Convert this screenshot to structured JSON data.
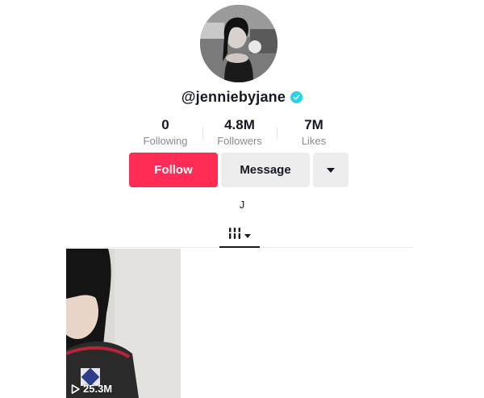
{
  "profile": {
    "handle": "@jenniebyjane",
    "verified": true,
    "bio": "J"
  },
  "stats": [
    {
      "value": "0",
      "label": "Following"
    },
    {
      "value": "4.8M",
      "label": "Followers"
    },
    {
      "value": "7M",
      "label": "Likes"
    }
  ],
  "actions": {
    "follow_label": "Follow",
    "message_label": "Message",
    "more_icon": "caret-down-icon"
  },
  "tabs": {
    "active": "videos-grid-icon"
  },
  "videos": [
    {
      "views": "25.3M"
    }
  ],
  "colors": {
    "follow_bg": "#fe2c55",
    "secondary_bg": "#ededee",
    "verified": "#20d5ec",
    "muted_text": "#8a8b91"
  }
}
